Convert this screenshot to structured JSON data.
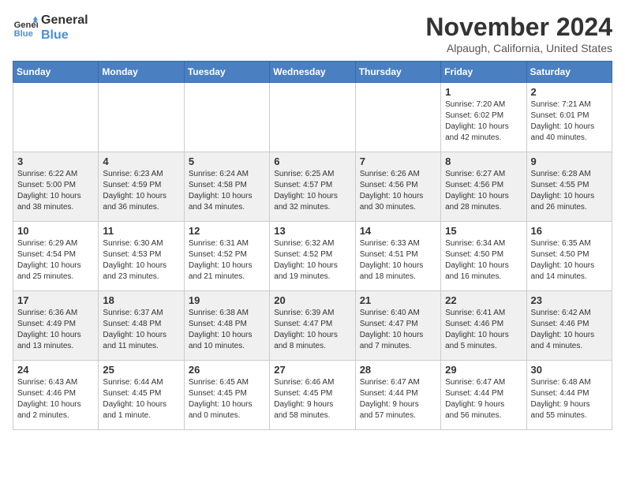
{
  "header": {
    "logo_line1": "General",
    "logo_line2": "Blue",
    "month_title": "November 2024",
    "location": "Alpaugh, California, United States"
  },
  "weekdays": [
    "Sunday",
    "Monday",
    "Tuesday",
    "Wednesday",
    "Thursday",
    "Friday",
    "Saturday"
  ],
  "weeks": [
    [
      {
        "day": "",
        "info": ""
      },
      {
        "day": "",
        "info": ""
      },
      {
        "day": "",
        "info": ""
      },
      {
        "day": "",
        "info": ""
      },
      {
        "day": "",
        "info": ""
      },
      {
        "day": "1",
        "info": "Sunrise: 7:20 AM\nSunset: 6:02 PM\nDaylight: 10 hours\nand 42 minutes."
      },
      {
        "day": "2",
        "info": "Sunrise: 7:21 AM\nSunset: 6:01 PM\nDaylight: 10 hours\nand 40 minutes."
      }
    ],
    [
      {
        "day": "3",
        "info": "Sunrise: 6:22 AM\nSunset: 5:00 PM\nDaylight: 10 hours\nand 38 minutes."
      },
      {
        "day": "4",
        "info": "Sunrise: 6:23 AM\nSunset: 4:59 PM\nDaylight: 10 hours\nand 36 minutes."
      },
      {
        "day": "5",
        "info": "Sunrise: 6:24 AM\nSunset: 4:58 PM\nDaylight: 10 hours\nand 34 minutes."
      },
      {
        "day": "6",
        "info": "Sunrise: 6:25 AM\nSunset: 4:57 PM\nDaylight: 10 hours\nand 32 minutes."
      },
      {
        "day": "7",
        "info": "Sunrise: 6:26 AM\nSunset: 4:56 PM\nDaylight: 10 hours\nand 30 minutes."
      },
      {
        "day": "8",
        "info": "Sunrise: 6:27 AM\nSunset: 4:56 PM\nDaylight: 10 hours\nand 28 minutes."
      },
      {
        "day": "9",
        "info": "Sunrise: 6:28 AM\nSunset: 4:55 PM\nDaylight: 10 hours\nand 26 minutes."
      }
    ],
    [
      {
        "day": "10",
        "info": "Sunrise: 6:29 AM\nSunset: 4:54 PM\nDaylight: 10 hours\nand 25 minutes."
      },
      {
        "day": "11",
        "info": "Sunrise: 6:30 AM\nSunset: 4:53 PM\nDaylight: 10 hours\nand 23 minutes."
      },
      {
        "day": "12",
        "info": "Sunrise: 6:31 AM\nSunset: 4:52 PM\nDaylight: 10 hours\nand 21 minutes."
      },
      {
        "day": "13",
        "info": "Sunrise: 6:32 AM\nSunset: 4:52 PM\nDaylight: 10 hours\nand 19 minutes."
      },
      {
        "day": "14",
        "info": "Sunrise: 6:33 AM\nSunset: 4:51 PM\nDaylight: 10 hours\nand 18 minutes."
      },
      {
        "day": "15",
        "info": "Sunrise: 6:34 AM\nSunset: 4:50 PM\nDaylight: 10 hours\nand 16 minutes."
      },
      {
        "day": "16",
        "info": "Sunrise: 6:35 AM\nSunset: 4:50 PM\nDaylight: 10 hours\nand 14 minutes."
      }
    ],
    [
      {
        "day": "17",
        "info": "Sunrise: 6:36 AM\nSunset: 4:49 PM\nDaylight: 10 hours\nand 13 minutes."
      },
      {
        "day": "18",
        "info": "Sunrise: 6:37 AM\nSunset: 4:48 PM\nDaylight: 10 hours\nand 11 minutes."
      },
      {
        "day": "19",
        "info": "Sunrise: 6:38 AM\nSunset: 4:48 PM\nDaylight: 10 hours\nand 10 minutes."
      },
      {
        "day": "20",
        "info": "Sunrise: 6:39 AM\nSunset: 4:47 PM\nDaylight: 10 hours\nand 8 minutes."
      },
      {
        "day": "21",
        "info": "Sunrise: 6:40 AM\nSunset: 4:47 PM\nDaylight: 10 hours\nand 7 minutes."
      },
      {
        "day": "22",
        "info": "Sunrise: 6:41 AM\nSunset: 4:46 PM\nDaylight: 10 hours\nand 5 minutes."
      },
      {
        "day": "23",
        "info": "Sunrise: 6:42 AM\nSunset: 4:46 PM\nDaylight: 10 hours\nand 4 minutes."
      }
    ],
    [
      {
        "day": "24",
        "info": "Sunrise: 6:43 AM\nSunset: 4:46 PM\nDaylight: 10 hours\nand 2 minutes."
      },
      {
        "day": "25",
        "info": "Sunrise: 6:44 AM\nSunset: 4:45 PM\nDaylight: 10 hours\nand 1 minute."
      },
      {
        "day": "26",
        "info": "Sunrise: 6:45 AM\nSunset: 4:45 PM\nDaylight: 10 hours\nand 0 minutes."
      },
      {
        "day": "27",
        "info": "Sunrise: 6:46 AM\nSunset: 4:45 PM\nDaylight: 9 hours\nand 58 minutes."
      },
      {
        "day": "28",
        "info": "Sunrise: 6:47 AM\nSunset: 4:44 PM\nDaylight: 9 hours\nand 57 minutes."
      },
      {
        "day": "29",
        "info": "Sunrise: 6:47 AM\nSunset: 4:44 PM\nDaylight: 9 hours\nand 56 minutes."
      },
      {
        "day": "30",
        "info": "Sunrise: 6:48 AM\nSunset: 4:44 PM\nDaylight: 9 hours\nand 55 minutes."
      }
    ]
  ]
}
